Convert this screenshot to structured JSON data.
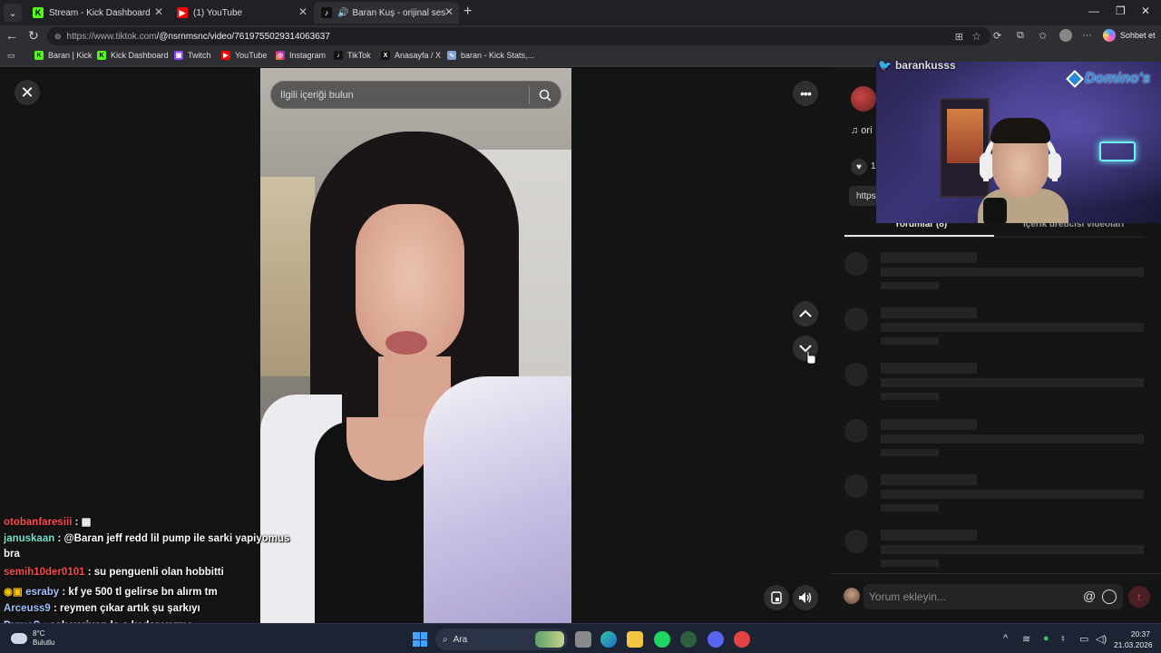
{
  "browser": {
    "tabs": [
      {
        "label": "Stream - Kick Dashboard",
        "icon": "kick-icon"
      },
      {
        "label": "(1) YouTube",
        "icon": "youtube-icon"
      },
      {
        "label": "Baran Kuş - orijinal ses | TikTo",
        "icon": "tiktok-icon",
        "active": true
      }
    ],
    "url_host": "https://www.tiktok.com",
    "url_path": "/@nsrnmsnc/video/7619755029314063637",
    "copilot_label": "Sohbet et",
    "bookmarks": [
      {
        "label": "Baran | Kick",
        "icon": "kick-icon"
      },
      {
        "label": "Kick Dashboard",
        "icon": "kick-icon"
      },
      {
        "label": "Twitch",
        "icon": "twitch-icon"
      },
      {
        "label": "YouTube",
        "icon": "youtube-icon"
      },
      {
        "label": "Instagram",
        "icon": "instagram-icon"
      },
      {
        "label": "TikTok",
        "icon": "tiktok-icon"
      },
      {
        "label": "Anasayfa / X",
        "icon": "x-icon"
      },
      {
        "label": "baran - Kick Stats,...",
        "icon": "stats-icon"
      }
    ]
  },
  "tiktok": {
    "search_placeholder": "İlgili içeriği bulun",
    "music_label": "♫  ori",
    "like_count": "1",
    "link_text": "https",
    "tabs": [
      "Yorumlar (8)",
      "İçerik üreticisi videoları"
    ],
    "comment_placeholder": "Yorum ekleyin..."
  },
  "stream_overlay": {
    "twitter_handle": "barankusss",
    "sponsor": "Domino's"
  },
  "chat": [
    {
      "user": "otobanfaresiii",
      "color": "#ff4d4d",
      "text": " : ▦"
    },
    {
      "user": "januskaan",
      "color": "#6fe5d2",
      "text": " : @Baran jeff redd lil pump ile sarki yapiyomus"
    },
    {
      "user": "",
      "color": "#ffffff",
      "text": "bra"
    },
    {
      "user": "semih10der0101",
      "color": "#ff4a4a",
      "text": " : su penguenli olan hobbitti"
    },
    {
      "user": "esraby",
      "color": "#9fc4ff",
      "text": " : kf ye 500 tl gelirse bn alırm tm"
    },
    {
      "user": "Arceuss9",
      "color": "#9fc4ff",
      "text": " : reymen çıkar artık şu şarkıyı"
    },
    {
      "user": "DyrusS",
      "color": "#bcd6ff",
      "text": " : çok veriyon la o kadar verme"
    }
  ],
  "taskbar": {
    "weather_temp": "8°C",
    "weather_desc": "Bulutlu",
    "search_label": "Ara",
    "time": "20:37",
    "date": "21.03.2026"
  },
  "colors": {
    "tiktok_red": "#fe2c55",
    "kick_green": "#53fc18",
    "youtube_red": "#ff0000"
  }
}
